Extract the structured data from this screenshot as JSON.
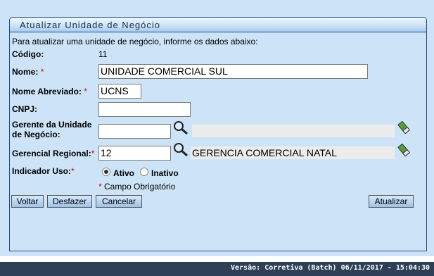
{
  "form": {
    "title": "Atualizar Unidade de Negócio",
    "intro": "Para atualizar uma unidade de negócio, informe os dados abaixo:",
    "required_mark": "*",
    "codigo": {
      "label": "Código:",
      "value": "11"
    },
    "nome": {
      "label": "Nome:",
      "value": "UNIDADE COMERCIAL SUL"
    },
    "nome_abreviado": {
      "label": "Nome Abreviado:",
      "value": "UCNS"
    },
    "cnpj": {
      "label": "CNPJ:",
      "value": ""
    },
    "gerente": {
      "label_line1": "Gerente da Unidade",
      "label_line2": "de Negócio:",
      "value": "",
      "description": ""
    },
    "gerencial_regional": {
      "label": "Gerencial Regional:",
      "value": "12",
      "description": "GERENCIA COMERCIAL NATAL"
    },
    "indicador_uso": {
      "label": "Indicador Uso:",
      "options": [
        "Ativo",
        "Inativo"
      ],
      "selected": "Ativo"
    },
    "note": "Campo Obrigatório"
  },
  "buttons": {
    "voltar": "Voltar",
    "desfazer": "Desfazer",
    "cancelar": "Cancelar",
    "atualizar": "Atualizar"
  },
  "footer": {
    "version": "Versão: Corretiva (Batch) 06/11/2017 - 15:04:30"
  },
  "icons": {
    "search": "magnifier-icon",
    "clear": "eraser-icon"
  },
  "colors": {
    "panel_bg": "#cde3f7",
    "border": "#1f4e8c",
    "required": "#d00000",
    "footer_bg": "#2e3f57"
  }
}
